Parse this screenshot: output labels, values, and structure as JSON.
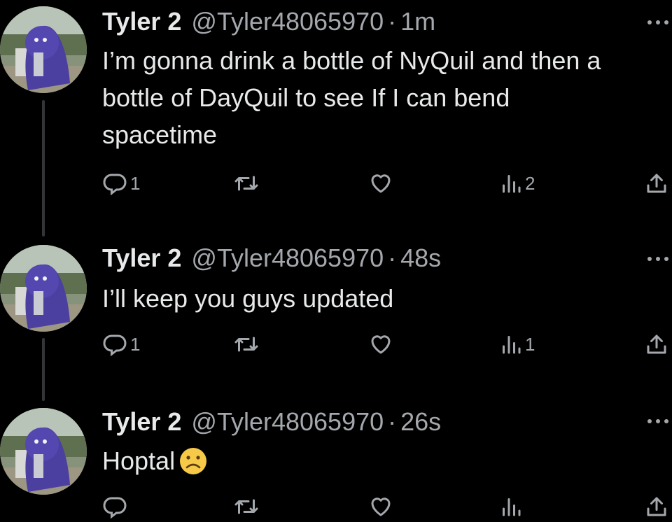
{
  "colors": {
    "background": "#000000",
    "text": "#e7e9ea",
    "secondary": "#a4a8ac",
    "thread_line": "#333639"
  },
  "tweets": [
    {
      "display_name": "Tyler 2",
      "handle": "@Tyler48065970",
      "separator": "·",
      "time": "1m",
      "text_lines": [
        "I’m gonna drink a bottle of NyQuil and then a",
        "bottle of DayQuil to see If I can bend",
        "spacetime"
      ],
      "reply_count": "1",
      "view_count": "2",
      "icons": [
        "avatar",
        "more-icon",
        "reply-icon",
        "retweet-icon",
        "like-icon",
        "views-icon",
        "share-icon"
      ]
    },
    {
      "display_name": "Tyler 2",
      "handle": "@Tyler48065970",
      "separator": "·",
      "time": "48s",
      "text_lines": [
        "I’ll keep you guys updated"
      ],
      "reply_count": "1",
      "view_count": "1",
      "icons": [
        "avatar",
        "more-icon",
        "reply-icon",
        "retweet-icon",
        "like-icon",
        "views-icon",
        "share-icon"
      ]
    },
    {
      "display_name": "Tyler 2",
      "handle": "@Tyler48065970",
      "separator": "·",
      "time": "26s",
      "text_lines": [
        "Hoptal"
      ],
      "emoji": "frowning-face-emoji",
      "icons": [
        "avatar",
        "more-icon",
        "reply-icon",
        "retweet-icon",
        "like-icon",
        "views-icon",
        "share-icon"
      ]
    }
  ]
}
